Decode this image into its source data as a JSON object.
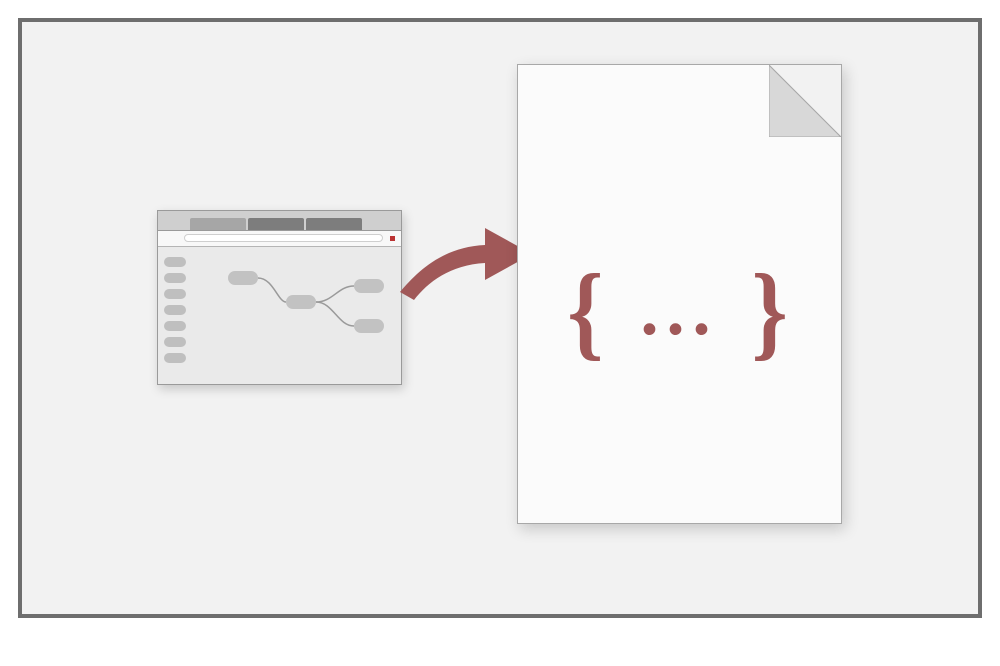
{
  "diagram": {
    "left": {
      "type": "browser-window",
      "tabs_count": 3
    },
    "arrow_direction": "right",
    "right": {
      "type": "document",
      "brace_left": "{",
      "brace_right": "}",
      "ellipsis": "..."
    },
    "color_accent": "#a05858"
  }
}
